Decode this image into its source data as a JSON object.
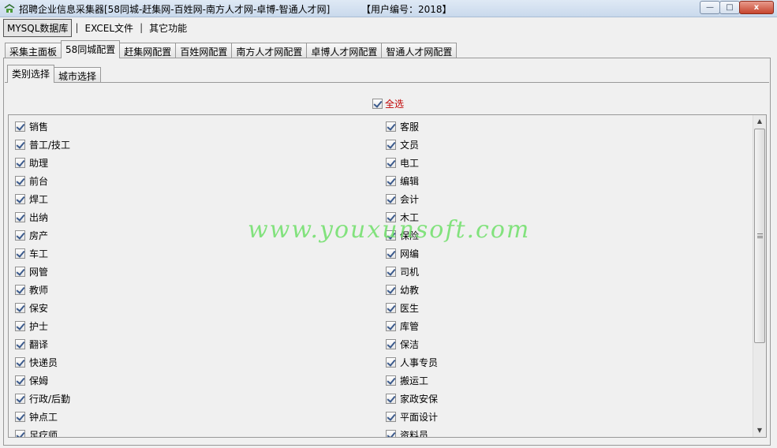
{
  "window": {
    "title": "招聘企业信息采集器[58同城-赶集网-百姓网-南方人才网-卓博-智通人才网]",
    "user_id": "【用户编号：2018】",
    "minimize": "—",
    "maximize": "□",
    "close": "x"
  },
  "menu": {
    "items": [
      {
        "label": "MYSQL数据库"
      },
      {
        "label": "EXCEL文件"
      },
      {
        "label": "其它功能"
      }
    ],
    "separator": "|"
  },
  "tabs": {
    "main": [
      {
        "label": "采集主面板"
      },
      {
        "label": "58同城配置"
      },
      {
        "label": "赶集网配置"
      },
      {
        "label": "百姓网配置"
      },
      {
        "label": "南方人才网配置"
      },
      {
        "label": "卓博人才网配置"
      },
      {
        "label": "智通人才网配置"
      }
    ],
    "sub": [
      {
        "label": "类别选择"
      },
      {
        "label": "城市选择"
      }
    ]
  },
  "select_all": {
    "label": "全选",
    "checked": true
  },
  "categories": {
    "left": [
      "销售",
      "普工/技工",
      "助理",
      "前台",
      "焊工",
      "出纳",
      "房产",
      "车工",
      "网管",
      "教师",
      "保安",
      "护士",
      "翻译",
      "快递员",
      "保姆",
      "行政/后勤",
      "钟点工",
      "足疗师"
    ],
    "right": [
      "客服",
      "文员",
      "电工",
      "编辑",
      "会计",
      "木工",
      "保险",
      "网编",
      "司机",
      "幼教",
      "医生",
      "库管",
      "保洁",
      "人事专员",
      "搬运工",
      "家政安保",
      "平面设计",
      "资料员"
    ]
  },
  "watermark": "www.youxunsoft.com",
  "icons": {
    "app": "recruit-app-icon",
    "scroll_up": "▲",
    "scroll_down": "▼"
  },
  "colors": {
    "select_all_label": "#c00000",
    "watermark": "#6fe06a"
  }
}
